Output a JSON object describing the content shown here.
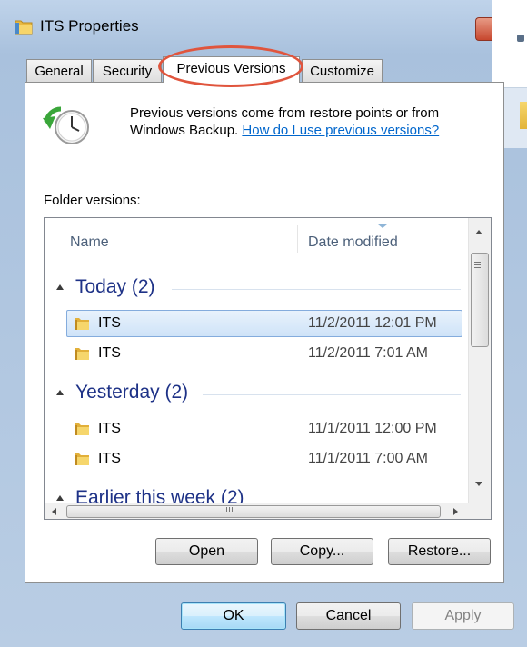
{
  "window": {
    "title": "ITS Properties"
  },
  "tabs": [
    {
      "label": "General",
      "active": false
    },
    {
      "label": "Security",
      "active": false
    },
    {
      "label": "Previous Versions",
      "active": true
    },
    {
      "label": "Customize",
      "active": false
    }
  ],
  "description": {
    "text": "Previous versions come from restore points or from Windows Backup.",
    "link": "How do I use previous versions?"
  },
  "folder_versions_label": "Folder versions:",
  "columns": {
    "name": "Name",
    "date": "Date modified"
  },
  "groups": [
    {
      "label": "Today (2)",
      "items": [
        {
          "name": "ITS",
          "date": "11/2/2011 12:01 PM",
          "selected": true
        },
        {
          "name": "ITS",
          "date": "11/2/2011 7:01 AM",
          "selected": false
        }
      ]
    },
    {
      "label": "Yesterday (2)",
      "items": [
        {
          "name": "ITS",
          "date": "11/1/2011 12:00 PM",
          "selected": false
        },
        {
          "name": "ITS",
          "date": "11/1/2011 7:00 AM",
          "selected": false
        }
      ]
    },
    {
      "label": "Earlier this week (2)",
      "items": []
    }
  ],
  "action_buttons": {
    "open": "Open",
    "copy": "Copy...",
    "restore": "Restore..."
  },
  "dialog_buttons": {
    "ok": "OK",
    "cancel": "Cancel",
    "apply": "Apply"
  },
  "colors": {
    "highlight_oval": "#e0553d",
    "group_header": "#1e3287",
    "link": "#0066cc"
  },
  "icons": {
    "title": "folder-icon",
    "panel": "clock-restore-icon",
    "rows": "folder-icon"
  }
}
